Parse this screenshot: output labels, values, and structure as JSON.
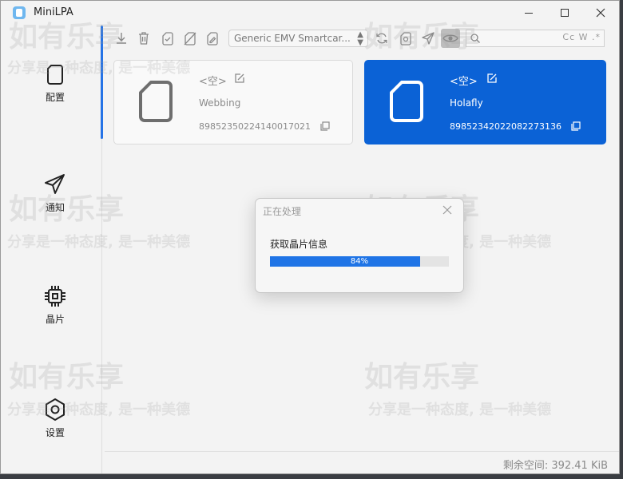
{
  "window": {
    "title": "MiniLPA",
    "controls": {
      "minimize": "minimize",
      "maximize": "maximize",
      "close": "close"
    }
  },
  "sidebar": {
    "items": [
      {
        "label": "配置",
        "icon": "sim-card-icon",
        "active": true
      },
      {
        "label": "通知",
        "icon": "paper-plane-icon",
        "active": false
      },
      {
        "label": "晶片",
        "icon": "chip-icon",
        "active": false
      },
      {
        "label": "设置",
        "icon": "hexagon-gear-icon",
        "active": false
      }
    ]
  },
  "toolbar": {
    "reader": "Generic EMV Smartcar...",
    "buttons": [
      "download-icon",
      "delete-icon",
      "enable-icon",
      "disable-icon",
      "rename-icon",
      "refresh-icon",
      "add-icon",
      "send-icon",
      "eye-icon"
    ],
    "search": {
      "value": "",
      "options": "Cc W .*"
    }
  },
  "profiles": [
    {
      "nickname": "<空>",
      "provider": "Webbing",
      "iccid": "89852350224140017021",
      "selected": false
    },
    {
      "nickname": "<空>",
      "provider": "Holafly",
      "iccid": "89852342022082273136",
      "selected": true
    }
  ],
  "dialog": {
    "title": "正在处理",
    "message": "获取晶片信息",
    "progress_percent": 84,
    "progress_label": "84%"
  },
  "status": {
    "free_space": "剩余空间: 392.41 KiB"
  },
  "watermark": {
    "main": "如有乐享",
    "sub": "分享是一种态度, 是一种美德"
  },
  "colors": {
    "accent": "#0b62d6",
    "progress": "#1f74e6",
    "sidebar_indicator": "#2573e6"
  }
}
